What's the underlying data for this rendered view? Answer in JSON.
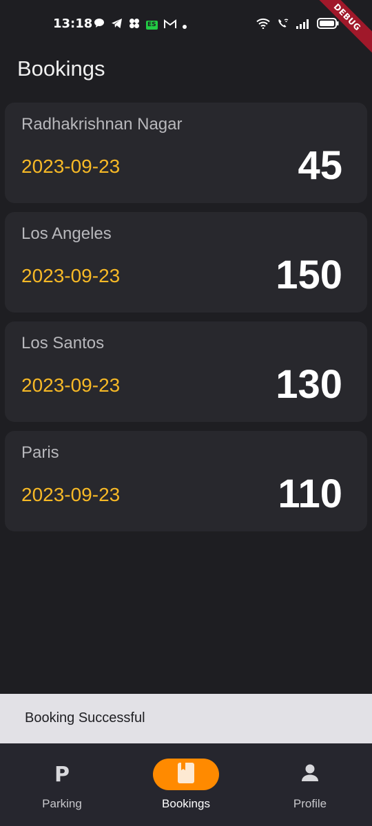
{
  "status_bar": {
    "time": "13:18",
    "es_badge": "ES",
    "icons": [
      "chat-icon",
      "telegram-icon",
      "fan-icon",
      "es-icon",
      "gmail-icon",
      "dot-icon",
      "wifi-icon",
      "wifi-call-icon",
      "signal-icon",
      "battery-icon"
    ]
  },
  "debug_banner": "DEBUG",
  "page": {
    "title": "Bookings"
  },
  "bookings": [
    {
      "location": "Radhakrishnan Nagar",
      "date": "2023-09-23",
      "count": "45"
    },
    {
      "location": "Los Angeles",
      "date": "2023-09-23",
      "count": "150"
    },
    {
      "location": "Los Santos",
      "date": "2023-09-23",
      "count": "130"
    },
    {
      "location": "Paris",
      "date": "2023-09-23",
      "count": "110"
    }
  ],
  "snackbar": {
    "message": "Booking Successful"
  },
  "bottom_nav": {
    "items": [
      {
        "label": "Parking",
        "icon": "parking-icon",
        "glyph": "P",
        "active": false
      },
      {
        "label": "Bookings",
        "icon": "bookmark-icon",
        "active": true
      },
      {
        "label": "Profile",
        "icon": "person-icon",
        "active": false
      }
    ]
  },
  "colors": {
    "background": "#1e1e22",
    "card": "#28282d",
    "date_accent": "#f7b926",
    "nav_active": "#ff8a00",
    "debug_banner": "#a0182a"
  }
}
